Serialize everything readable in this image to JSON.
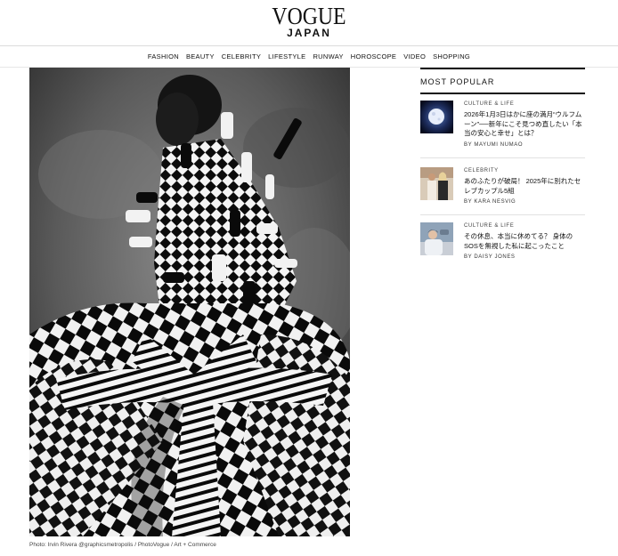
{
  "masthead": {
    "logo": "VOGUE",
    "edition": "JAPAN"
  },
  "nav": {
    "items": [
      "FASHION",
      "BEAUTY",
      "CELEBRITY",
      "LIFESTYLE",
      "RUNWAY",
      "HOROSCOPE",
      "VIDEO",
      "SHOPPING"
    ]
  },
  "hero": {
    "caption": "Photo: Irvin Rivera @graphicsmetropolis / PhotoVogue / Art + Commerce"
  },
  "sidebar": {
    "heading": "MOST POPULAR",
    "articles": [
      {
        "category": "CULTURE & LIFE",
        "title": "2026年1月3日はかに座の満月“ウルフムーン”──新年にこそ見つめ直したい「本当の安心と幸せ」とは？",
        "byline": "BY MAYUMI NUMAO"
      },
      {
        "category": "CELEBRITY",
        "title": "あのふたりが破局！ 2025年に別れたセレブカップル5組",
        "byline": "BY KARA NESVIG"
      },
      {
        "category": "CULTURE & LIFE",
        "title": "その休息、本当に休めてる？ 身体のSOSを無視した私に起こったこと",
        "byline": "BY DAISY JONES"
      }
    ]
  },
  "colors": {
    "text": "#111111",
    "rule": "#dcdcdc",
    "photo_bg": "#6c6c6c"
  }
}
